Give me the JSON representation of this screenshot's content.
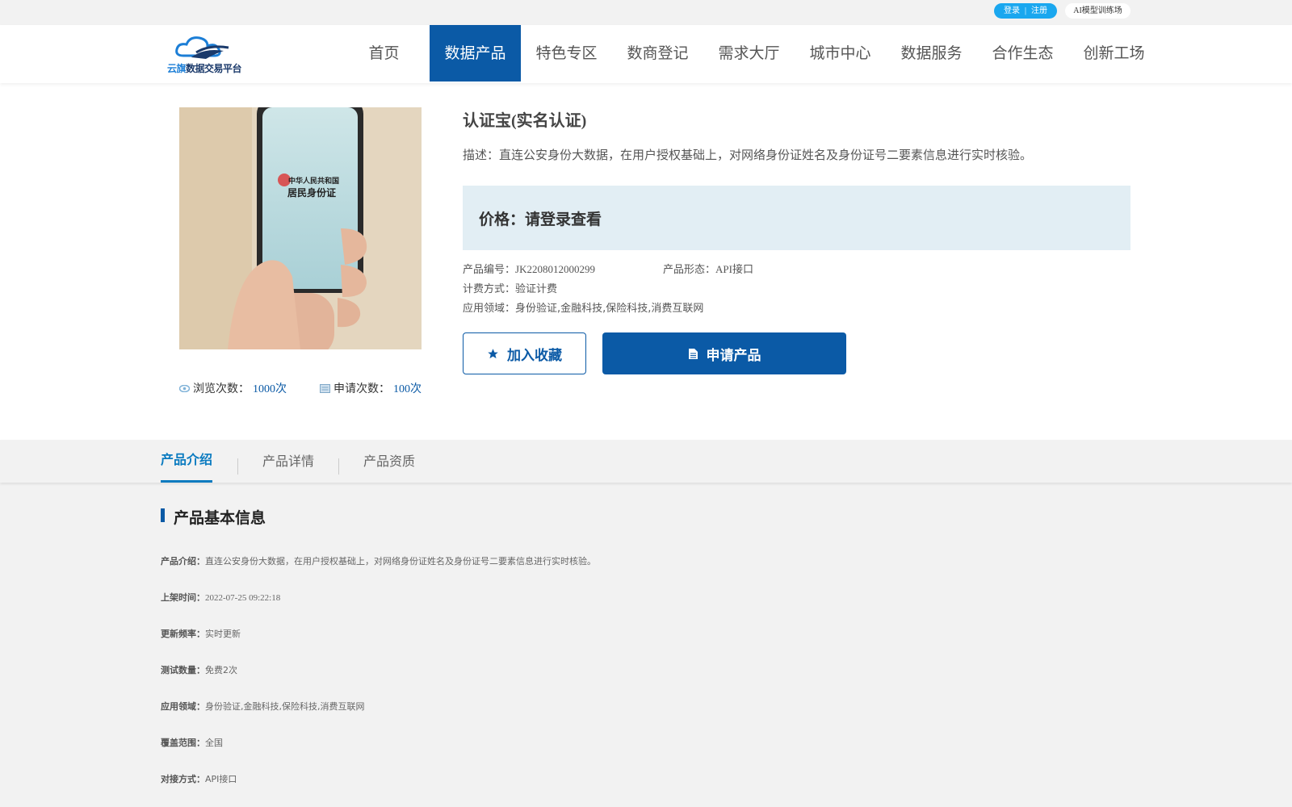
{
  "topbar": {
    "login": "登录",
    "divider": "|",
    "register": "注册",
    "ai_link": "AI模型训练场"
  },
  "logo": {
    "text_blue": "云旗",
    "text_rest": "数据交易平台"
  },
  "nav": {
    "items": [
      {
        "label": "首页"
      },
      {
        "label": "数据产品"
      },
      {
        "label": "特色专区"
      },
      {
        "label": "数商登记"
      },
      {
        "label": "需求大厅"
      },
      {
        "label": "城市中心"
      },
      {
        "label": "数据服务"
      },
      {
        "label": "合作生态"
      },
      {
        "label": "创新工场"
      }
    ],
    "active_index": 1
  },
  "product": {
    "image_alt": "身份证手机图片",
    "card_line1": "中华人民共和国",
    "card_line2": "居民身份证",
    "title": "认证宝(实名认证)",
    "description": "描述：直连公安身份大数据，在用户授权基础上，对网络身份证姓名及身份证号二要素信息进行实时核验。",
    "price": "价格：请登录查看",
    "code_label": "产品编号：",
    "code_value": "JK2208012000299",
    "form_label": "产品形态：",
    "form_value": "API接口",
    "billing_label": "计费方式：",
    "billing_value": "验证计费",
    "domain_label": "应用领域：",
    "domain_value": "身份验证,金融科技,保险科技,消费互联网",
    "views_label": "浏览次数：",
    "views_value": "1000次",
    "applies_label": "申请次数：",
    "applies_value": "100次",
    "fav_button": "加入收藏",
    "apply_button": "申请产品"
  },
  "tabs": [
    {
      "label": "产品介绍"
    },
    {
      "label": "产品详情"
    },
    {
      "label": "产品资质"
    }
  ],
  "section": {
    "title": "产品基本信息",
    "rows": [
      {
        "key": "产品介绍：",
        "value": "直连公安身份大数据，在用户授权基础上，对网络身份证姓名及身份证号二要素信息进行实时核验。"
      },
      {
        "key": "上架时间：",
        "value": "2022-07-25 09:22:18"
      },
      {
        "key": "更新频率：",
        "value": "实时更新"
      },
      {
        "key": "测试数量：",
        "value": "免费2次"
      },
      {
        "key": "应用领域：",
        "value": "身份验证,金融科技,保险科技,消费互联网"
      },
      {
        "key": "覆盖范围：",
        "value": "全国"
      },
      {
        "key": "对接方式：",
        "value": "API接口"
      }
    ]
  },
  "colors": {
    "primary": "#0b5aa6",
    "accent": "#1aa7ef",
    "price_bg": "#e2eef4",
    "lower_bg": "#f2f2f2"
  }
}
